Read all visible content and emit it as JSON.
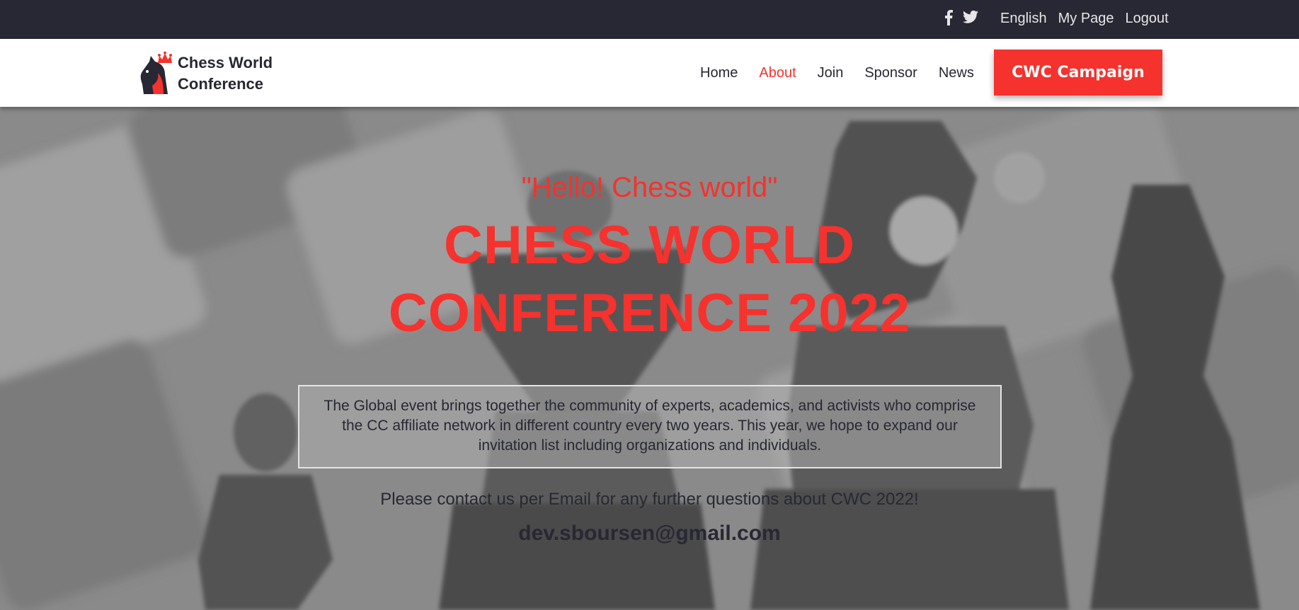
{
  "topbar": {
    "social_icons": [
      "facebook-icon",
      "twitter-icon"
    ],
    "links": [
      "English",
      "My Page",
      "Logout"
    ]
  },
  "navbar": {
    "logo_line1": "Chess World",
    "logo_line2": "Conference",
    "links": [
      "Home",
      "About",
      "Join",
      "Sponsor",
      "News"
    ],
    "active_link": "About",
    "cta_label": "CWC Campaign"
  },
  "hero": {
    "tagline": "\"Hello! Chess world\"",
    "title_line1": "CHESS WORLD",
    "title_line2": "CONFERENCE 2022",
    "description": "The Global event brings together the community of experts, academics, and activists who comprise the CC affiliate network in different country every two years. This year, we hope to expand our invitation list including organizations and individuals.",
    "contact_text": "Please contact us per Email for any further questions about CWC 2022!",
    "email": "dev.sboursen@gmail.com"
  },
  "colors": {
    "accent": "#f5322d",
    "dark": "#272833",
    "white": "#ffffff"
  }
}
